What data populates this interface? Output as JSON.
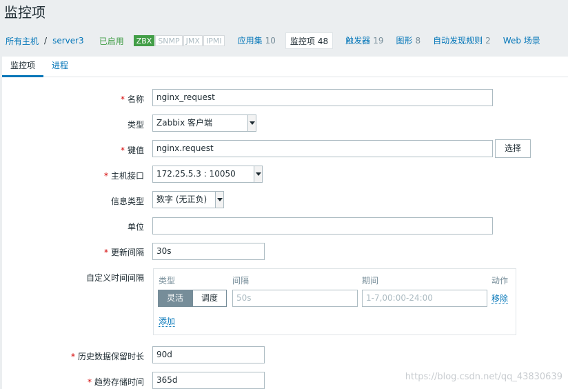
{
  "page": {
    "title": "监控项"
  },
  "breadcrumb": {
    "all_hosts": "所有主机",
    "separator": "/",
    "host": "server3",
    "status": "已启用",
    "badges": [
      {
        "label": "ZBX",
        "active": true
      },
      {
        "label": "SNMP",
        "active": false
      },
      {
        "label": "JMX",
        "active": false
      },
      {
        "label": "IPMI",
        "active": false
      }
    ],
    "tabs": [
      {
        "label": "应用集",
        "count": "10"
      },
      {
        "label": "监控项",
        "count": "48"
      },
      {
        "label": "触发器",
        "count": "19"
      },
      {
        "label": "图形",
        "count": "8"
      },
      {
        "label": "自动发现规则",
        "count": "2"
      },
      {
        "label": "Web 场景",
        "count": ""
      }
    ]
  },
  "form_tabs": [
    "监控项",
    "进程"
  ],
  "form": {
    "name_label": "名称",
    "name_value": "nginx_request",
    "type_label": "类型",
    "type_value": "Zabbix 客户端",
    "key_label": "键值",
    "key_value": "nginx.request",
    "select_button": "选择",
    "interface_label": "主机接口",
    "interface_value": "172.25.5.3 : 10050",
    "info_type_label": "信息类型",
    "info_type_value": "数字 (无正负)",
    "units_label": "单位",
    "units_value": "",
    "interval_label": "更新间隔",
    "interval_value": "30s",
    "custom_label": "自定义时间间隔",
    "custom": {
      "col_type": "类型",
      "col_interval": "间隔",
      "col_period": "期间",
      "col_action": "动作",
      "flexible": "灵活",
      "scheduling": "调度",
      "interval_placeholder": "50s",
      "period_placeholder": "1-7,00:00-24:00",
      "remove": "移除",
      "add": "添加"
    },
    "history_label": "历史数据保留时长",
    "history_value": "90d",
    "trends_label": "趋势存储时间",
    "trends_value": "365d"
  },
  "watermark": "https://blog.csdn.net/qq_43830639",
  "colors": {
    "link": "#0275b8",
    "enabled": "#429e47",
    "required": "#d40000"
  }
}
